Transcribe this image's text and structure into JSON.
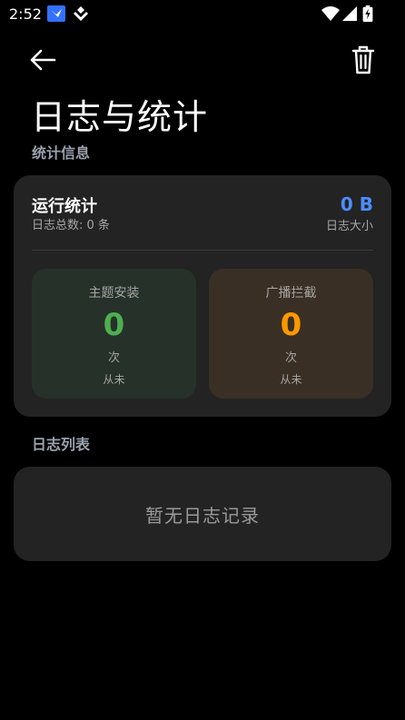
{
  "status_bar": {
    "time": "2:52",
    "icons": [
      "feishu-app-icon",
      "diamond-app-icon",
      "wifi-icon",
      "signal-icon",
      "battery-icon"
    ]
  },
  "app_bar": {
    "back_icon": "arrow-left-icon",
    "delete_icon": "trash-icon"
  },
  "page": {
    "title": "日志与统计"
  },
  "stats_section": {
    "label": "统计信息",
    "card": {
      "title": "运行统计",
      "total_count": "日志总数: 0 条",
      "log_size_value": "0 B",
      "log_size_label": "日志大小"
    },
    "theme_install": {
      "label": "主题安装",
      "value": "0",
      "unit": "次",
      "last_time": "从未",
      "color": "#4caf50"
    },
    "broadcast_block": {
      "label": "广播拦截",
      "value": "0",
      "unit": "次",
      "last_time": "从未",
      "color": "#ff9800"
    }
  },
  "log_section": {
    "label": "日志列表",
    "empty_text": "暂无日志记录"
  },
  "colors": {
    "background": "#000000",
    "card": "#232323",
    "accent_blue": "#4c8dff",
    "section_label": "#9aa1ad"
  }
}
